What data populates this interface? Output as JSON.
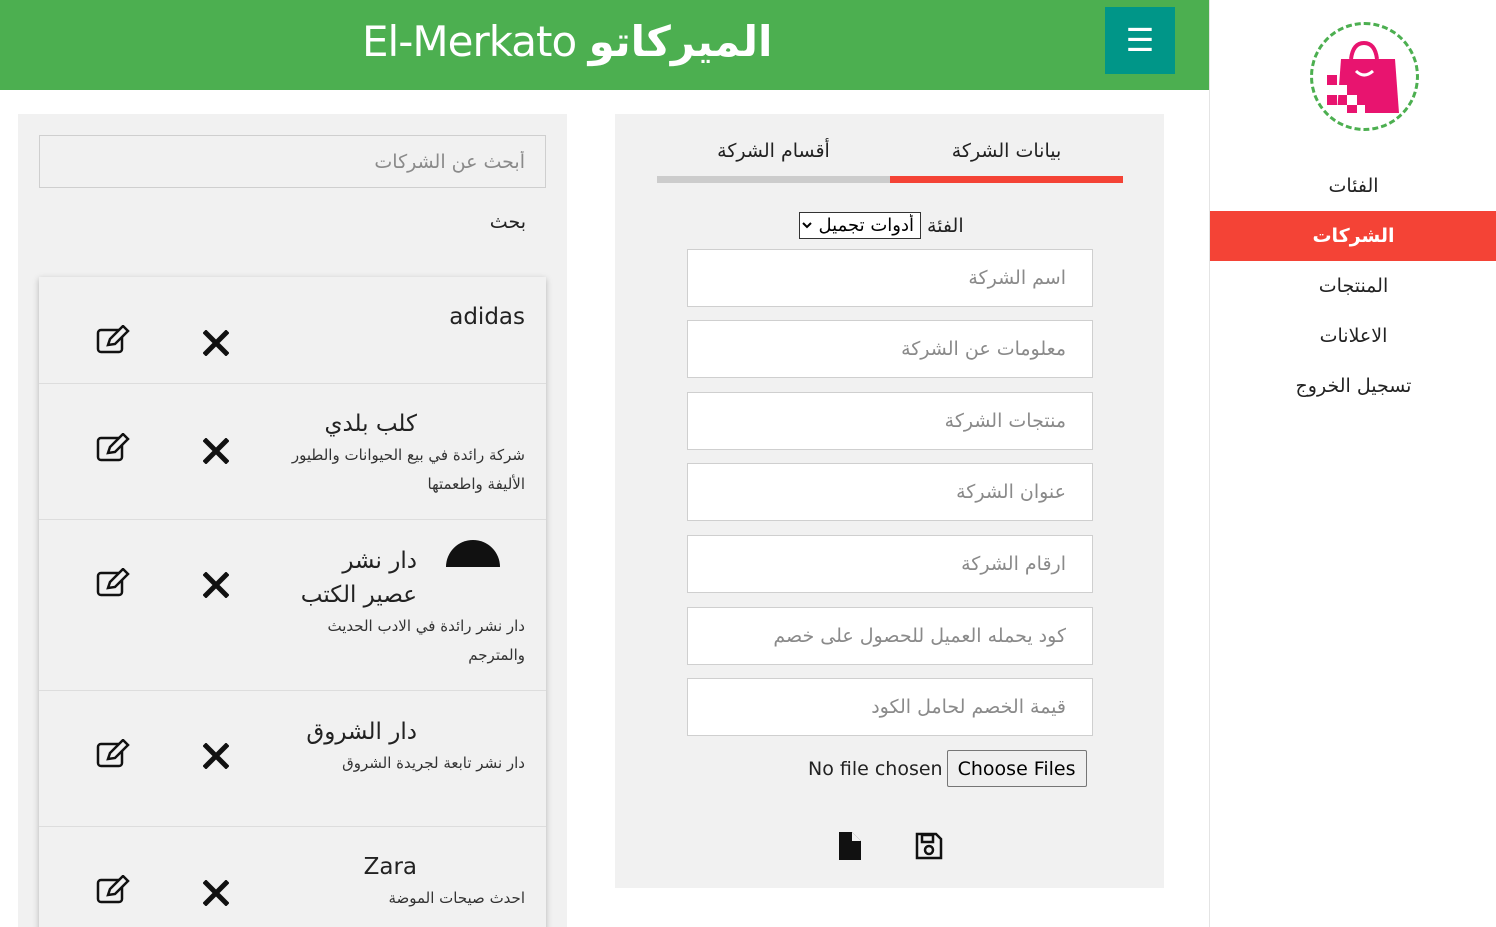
{
  "header": {
    "brand_latin": "El-Merkato",
    "brand_arabic": "الميركاتو",
    "menu_icon": "☰",
    "colors": {
      "header_bg": "#4caf50",
      "menu_bg": "#009688"
    }
  },
  "sidebar": {
    "logo_icon": "shopping-bag-logo",
    "items": [
      {
        "label": "الفئات",
        "active": false
      },
      {
        "label": "الشركات",
        "active": true
      },
      {
        "label": "المنتجات",
        "active": false
      },
      {
        "label": "الاعلانات",
        "active": false
      },
      {
        "label": "تسجيل الخروج",
        "active": false
      }
    ],
    "active_color": "#f44336"
  },
  "form": {
    "tabs": [
      {
        "label": "بيانات الشركة",
        "active": true
      },
      {
        "label": "أقسام الشركة",
        "active": false
      }
    ],
    "category_label": "الفئة",
    "category_selected": "أدوات تجميل",
    "fields": {
      "name": "اسم الشركة",
      "info": "معلومات عن الشركة",
      "products": "منتجات الشركة",
      "address": "عنوان الشركة",
      "phones": "ارقام الشركة",
      "discount_code": "كود يحمله العميل للحصول على خصم",
      "discount_value": "قيمة الخصم لحامل الكود"
    },
    "file_status": "No file chosen",
    "file_button": "Choose Files",
    "actions": {
      "new_icon": "new-file-icon",
      "save_icon": "save-icon"
    }
  },
  "list": {
    "search_placeholder": "أبحث عن الشركات",
    "search_label": "بحث",
    "companies": [
      {
        "name": "adidas",
        "desc": ""
      },
      {
        "name": "كلب بلدي",
        "desc": "شركة رائدة في بيع الحيوانات والطيور الأليفة واطعمتها"
      },
      {
        "name": "دار نشر عصير الكتب",
        "desc": "دار نشر رائدة في الادب الحديث والمترجم"
      },
      {
        "name": "دار الشروق",
        "desc": "دار نشر تابعة لجريدة الشروق"
      },
      {
        "name": "Zara",
        "desc": "احدث صيحات الموضة"
      }
    ],
    "row_icons": {
      "edit": "edit-icon",
      "delete": "delete-icon"
    }
  }
}
